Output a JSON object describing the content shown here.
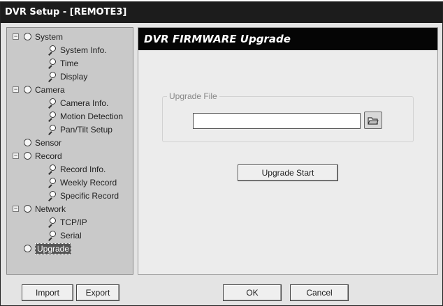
{
  "window": {
    "title": "DVR Setup - [REMOTE3]"
  },
  "tree": {
    "items": [
      {
        "label": "System",
        "level": 0,
        "type": "folder",
        "expander": "−"
      },
      {
        "label": "System Info.",
        "level": 1,
        "type": "leaf"
      },
      {
        "label": "Time",
        "level": 1,
        "type": "leaf"
      },
      {
        "label": "Display",
        "level": 1,
        "type": "leaf"
      },
      {
        "label": "Camera",
        "level": 0,
        "type": "folder",
        "expander": "−"
      },
      {
        "label": "Camera Info.",
        "level": 1,
        "type": "leaf"
      },
      {
        "label": "Motion Detection",
        "level": 1,
        "type": "leaf"
      },
      {
        "label": "Pan/Tilt Setup",
        "level": 1,
        "type": "leaf"
      },
      {
        "label": "Sensor",
        "level": 0,
        "type": "folder"
      },
      {
        "label": "Record",
        "level": 0,
        "type": "folder",
        "expander": "−"
      },
      {
        "label": "Record Info.",
        "level": 1,
        "type": "leaf"
      },
      {
        "label": "Weekly Record",
        "level": 1,
        "type": "leaf"
      },
      {
        "label": "Specific Record",
        "level": 1,
        "type": "leaf"
      },
      {
        "label": "Network",
        "level": 0,
        "type": "folder",
        "expander": "−"
      },
      {
        "label": "TCP/IP",
        "level": 1,
        "type": "leaf"
      },
      {
        "label": "Serial",
        "level": 1,
        "type": "leaf"
      },
      {
        "label": "Upgrade",
        "level": 0,
        "type": "folder",
        "selected": true
      }
    ]
  },
  "content": {
    "header": "DVR FIRMWARE Upgrade",
    "upgrade_file": {
      "legend": "Upgrade File",
      "value": "",
      "browse_icon": "folder-browse-icon"
    },
    "upgrade_start_label": "Upgrade Start"
  },
  "footer": {
    "import_label": "Import",
    "export_label": "Export",
    "ok_label": "OK",
    "cancel_label": "Cancel"
  }
}
